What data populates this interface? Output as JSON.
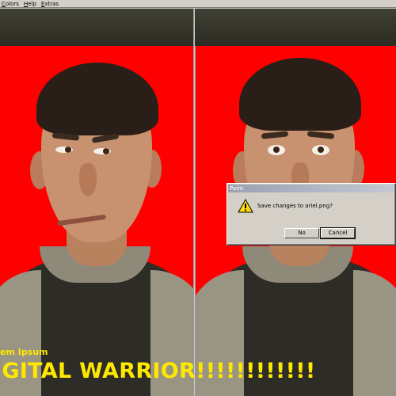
{
  "menu": {
    "items": [
      "Colors",
      "Help",
      "Extras"
    ]
  },
  "dialog": {
    "title": "Paint",
    "icon": "warning-icon",
    "message": "Save changes to ariel.png?",
    "buttons": {
      "no": "No",
      "cancel": "Cancel"
    }
  },
  "captions": {
    "small": "em Ipsum",
    "big": "IGITAL WARRIOR!!!!!!!!!!!!"
  },
  "colors": {
    "background": "#ff0000",
    "caption": "#ffe800",
    "dialog": "#d4d0c8"
  }
}
